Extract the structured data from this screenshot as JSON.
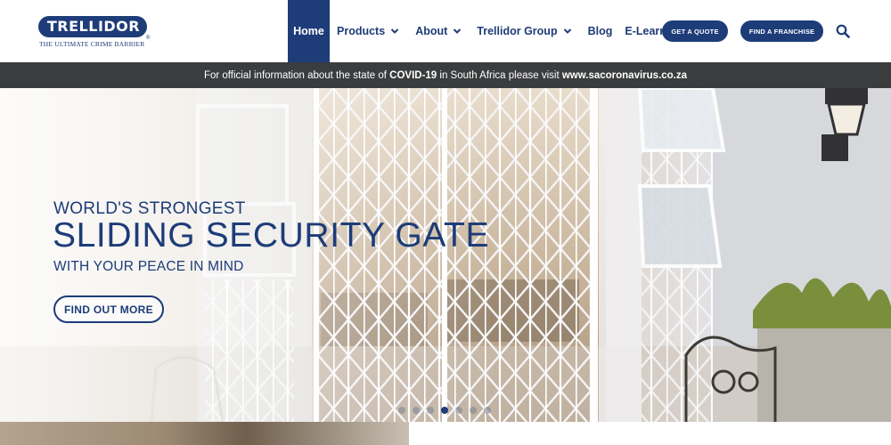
{
  "brand": {
    "name": "TRELLIDOR",
    "tagline": "THE ULTIMATE CRIME BARRIER",
    "registered": "®",
    "color": "#1d3c78"
  },
  "nav": {
    "items": [
      {
        "label": "Home",
        "active": true,
        "dropdown": false
      },
      {
        "label": "Products",
        "active": false,
        "dropdown": true
      },
      {
        "label": "About",
        "active": false,
        "dropdown": true
      },
      {
        "label": "Trellidor Group",
        "active": false,
        "dropdown": true
      },
      {
        "label": "Blog",
        "active": false,
        "dropdown": false
      },
      {
        "label": "E-Learning",
        "active": false,
        "dropdown": false
      }
    ],
    "quote_label": "GET A QUOTE",
    "franchise_label": "FIND A FRANCHISE",
    "search_icon": "search-icon"
  },
  "covid": {
    "prefix": "For official information about the state of ",
    "highlight": "COVID-19",
    "middle": " in South Africa please visit ",
    "link": "www.sacoronavirus.co.za",
    "bar_color": "#3a3c3e"
  },
  "hero": {
    "line1": "WORLD'S STRONGEST",
    "line2": "SLIDING SECURITY GATE",
    "line3": "WITH YOUR PEACE IN MIND",
    "cta_label": "FIND OUT MORE",
    "slides": {
      "count": 7,
      "active_index": 3
    }
  }
}
